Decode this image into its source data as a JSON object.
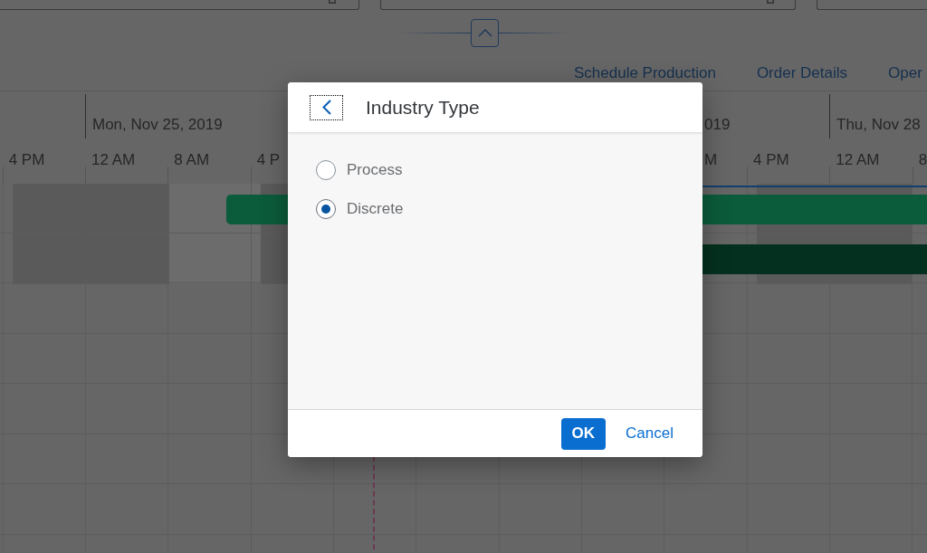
{
  "links": [
    "Schedule Production",
    "Order Details",
    "Oper"
  ],
  "timeline": {
    "left": {
      "dates": [
        "Mon, Nov 25, 2019"
      ],
      "hours": [
        "4 PM",
        "12 AM",
        "8 AM",
        "4 P"
      ]
    },
    "right": {
      "cut_date": "019",
      "dates": [
        "Thu, Nov 28"
      ],
      "cut_hour": "M",
      "hours": [
        "4 PM",
        "12 AM",
        "8"
      ]
    }
  },
  "gantt": {
    "bars": [
      {
        "color": "#0b5c3b"
      },
      {
        "color": "#04311f"
      }
    ]
  },
  "dialog": {
    "back_button": {
      "focused": true
    },
    "title": "Industry Type",
    "options": [
      {
        "label": "Process",
        "selected": false
      },
      {
        "label": "Discrete",
        "selected": true
      }
    ],
    "buttons": [
      {
        "label": "OK",
        "kind": "primary"
      },
      {
        "label": "Cancel",
        "kind": "transparent"
      }
    ]
  }
}
